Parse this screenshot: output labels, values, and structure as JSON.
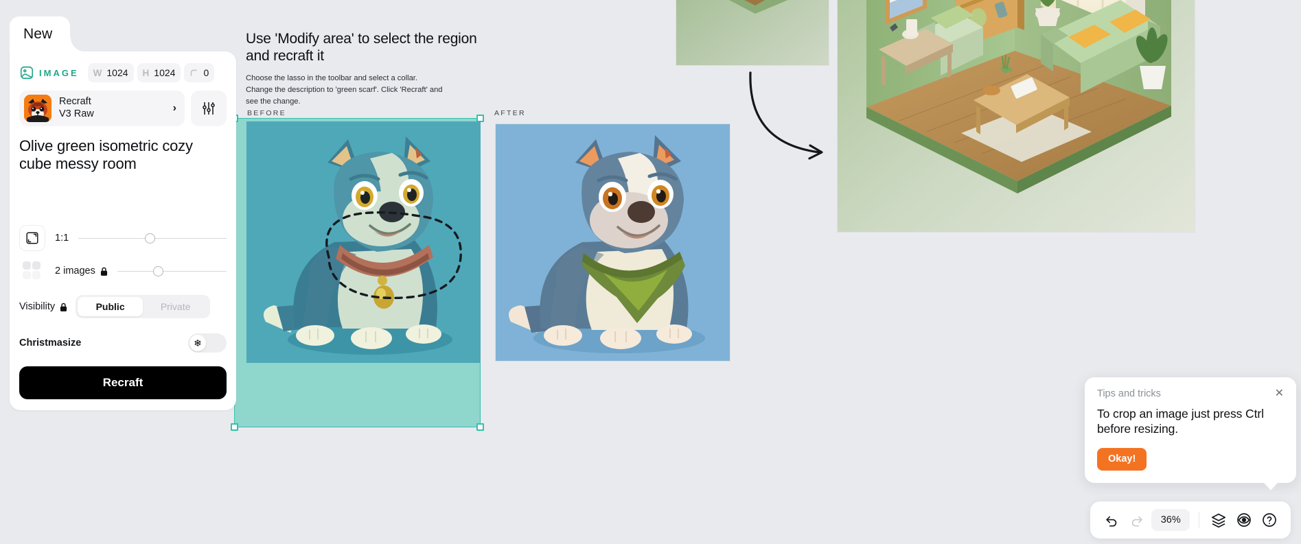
{
  "panel": {
    "new_tab_label": "New",
    "meta": {
      "type_icon": "image-icon",
      "type_label": "IMAGE",
      "width_key": "W",
      "width_value": "1024",
      "height_key": "H",
      "height_value": "1024",
      "rotation_key": "rotation-icon",
      "rotation_value": "0"
    },
    "model": {
      "thumb_icon": "red-panda-avatar",
      "name_line1": "Recraft",
      "name_line2": "V3 Raw",
      "chevron": "›",
      "settings_icon": "sliders-icon"
    },
    "prompt": "Olive green isometric cozy cube messy room",
    "aspect": {
      "icon": "aspect-ratio-icon",
      "label": "1:1",
      "slider_percent": 45
    },
    "count": {
      "icon": "grid-four-icon",
      "label": "2 images",
      "lock_icon": "🔒",
      "slider_percent": 33
    },
    "visibility": {
      "label": "Visibility",
      "lock_icon": "🔒",
      "options": [
        "Public",
        "Private"
      ],
      "selected": "Public"
    },
    "christmasize": {
      "label": "Christmasize",
      "toggle_icon": "❄",
      "enabled": false
    },
    "submit_label": "Recraft"
  },
  "canvas": {
    "instruction_title": "Use 'Modify area' to select the region  and recraft it",
    "instruction_body": "Choose the lasso in the toolbar and select a collar. Change the description to 'green scarf'. Click 'Recraft' and see the change.",
    "before_label": "BEFORE",
    "after_label": "AFTER",
    "arrow_icon": "curved-arrow-icon",
    "colors": {
      "selection_accent": "#34c0ae",
      "selection_fill": "#8fd6cd",
      "before_bg": "#4fa8b8",
      "after_bg": "#7fb2d6",
      "canvas_bg": "#e9eaee",
      "brand_teal": "#1fa88a",
      "accent_orange": "#f47322"
    }
  },
  "tips": {
    "title": "Tips and tricks",
    "close_icon": "✕",
    "body": "To crop an image just press Ctrl before resizing.",
    "button_label": "Okay!"
  },
  "toolbar": {
    "undo_icon": "undo-arrow-icon",
    "redo_icon": "redo-arrow-icon",
    "zoom_level": "36%",
    "layers_icon": "layers-icon",
    "preview_icon": "eye-icon",
    "help_icon": "question-circle-icon"
  }
}
